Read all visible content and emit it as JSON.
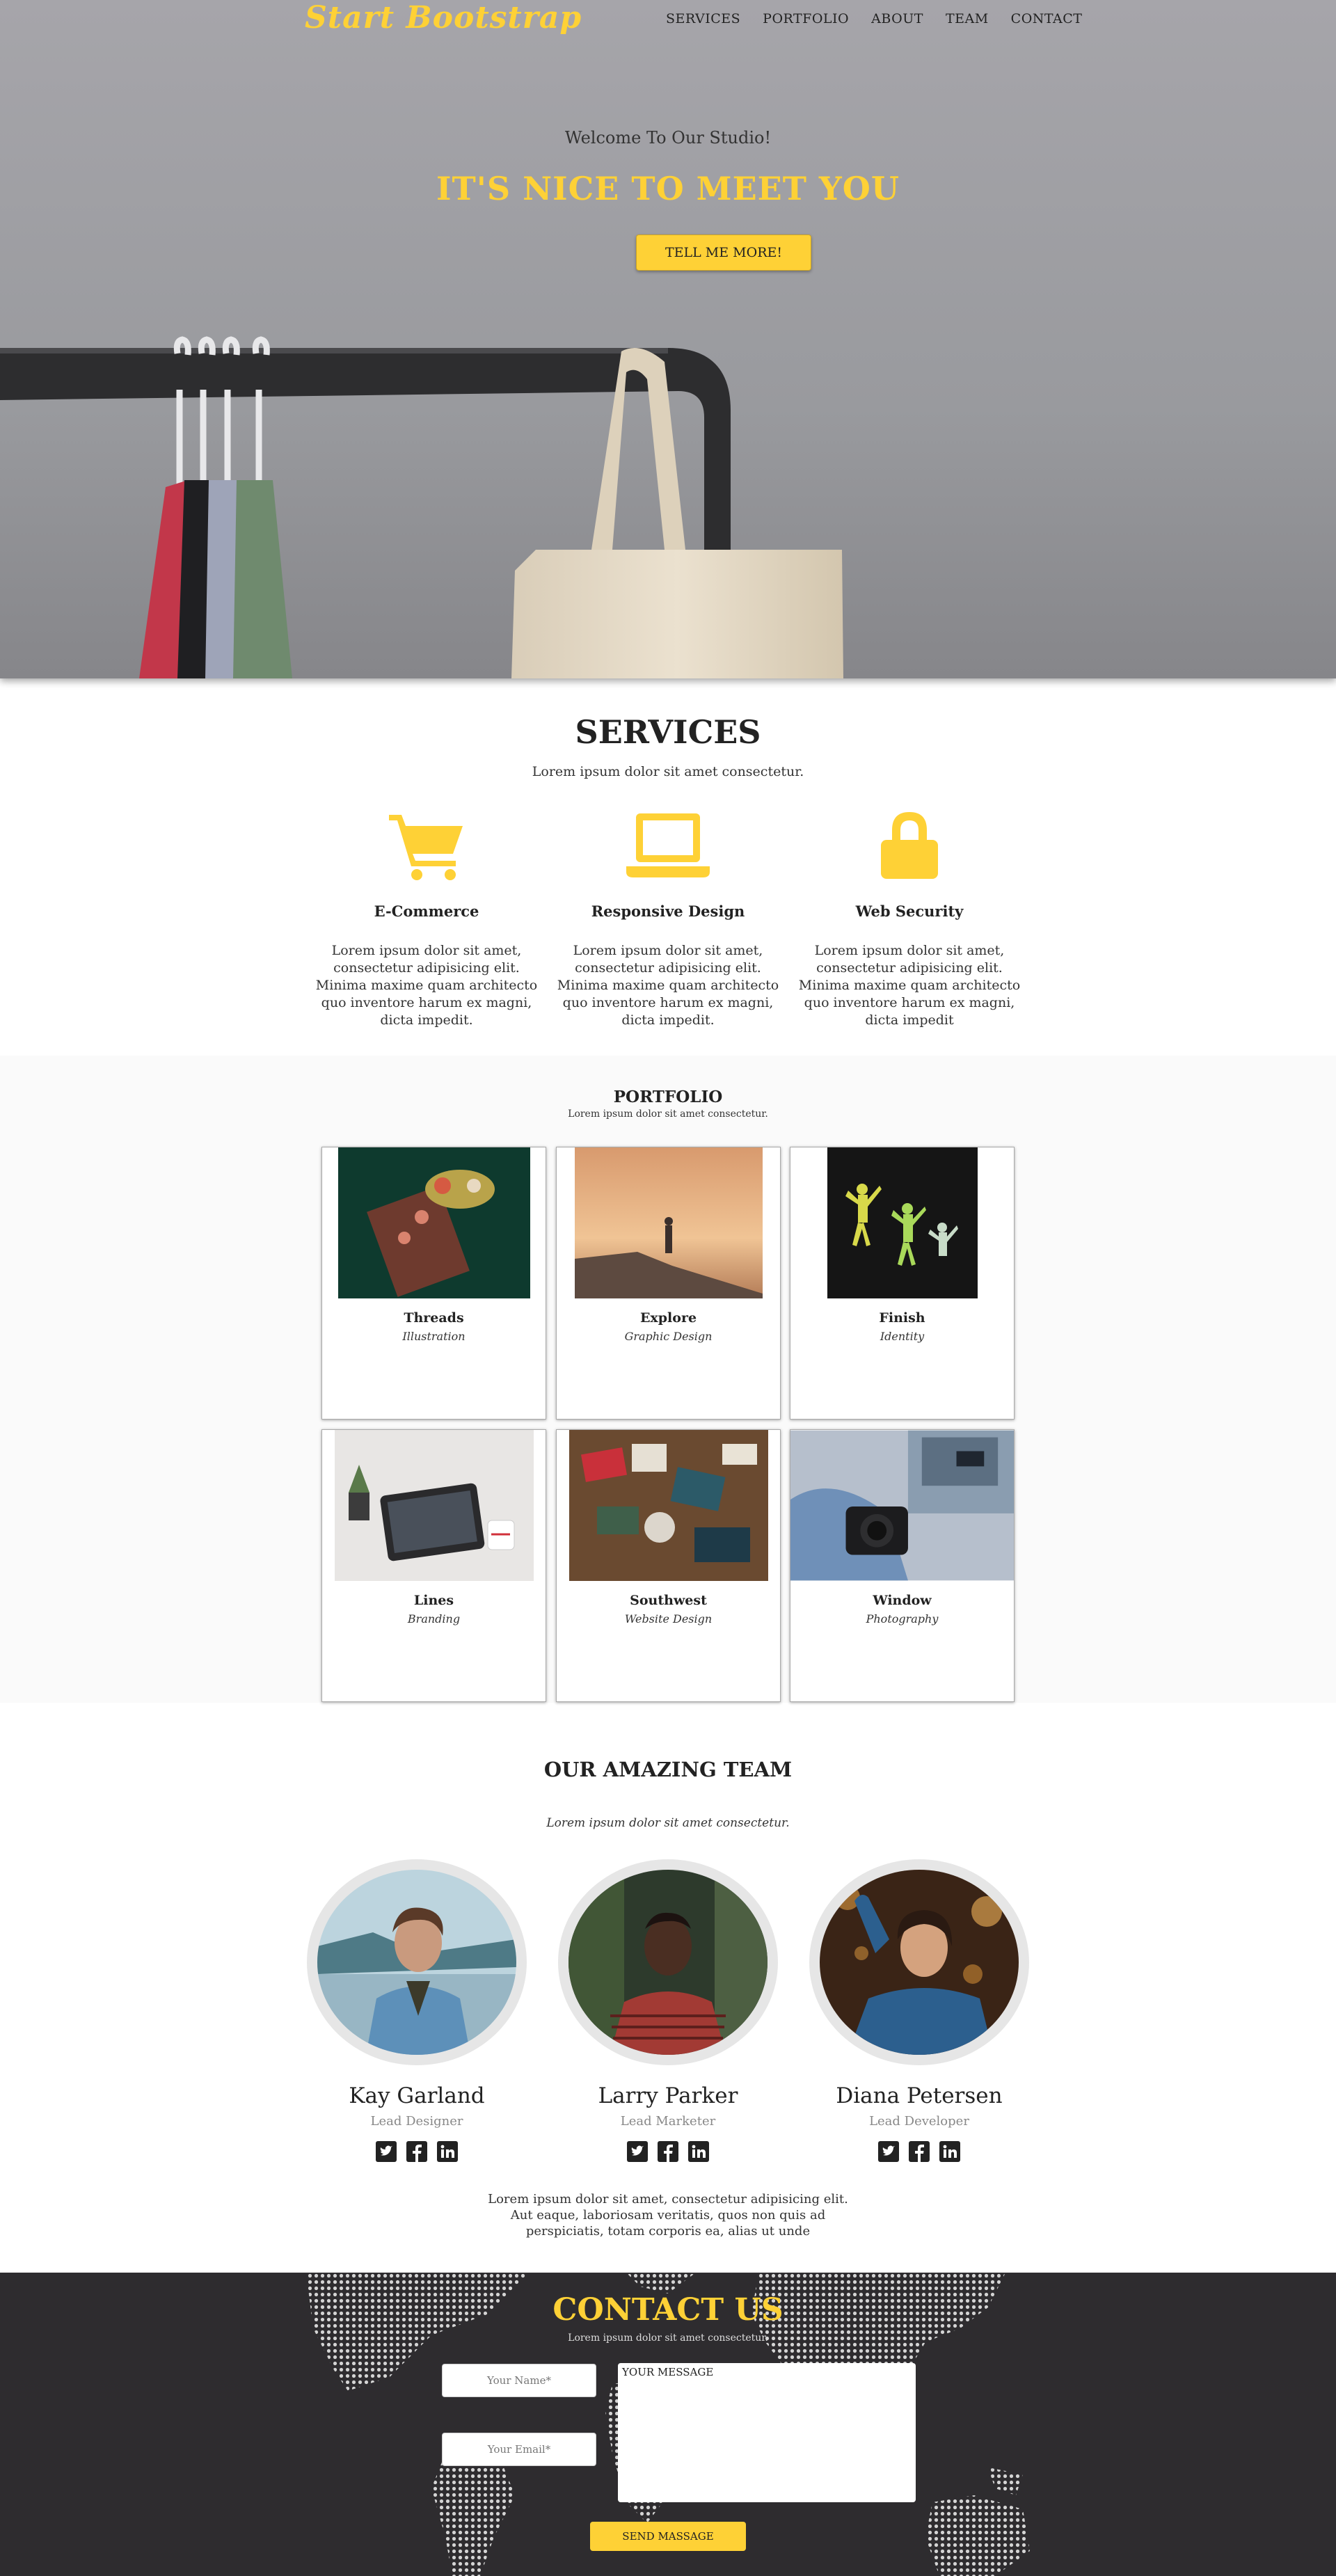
{
  "nav": {
    "brand": "Start Bootstrap",
    "items": [
      "SERVICES",
      "PORTFOLIO",
      "ABOUT",
      "TEAM",
      "CONTACT"
    ]
  },
  "hero": {
    "subtitle": "Welcome To Our Studio!",
    "title": "IT'S NICE TO MEET YOU",
    "button": "TELL ME MORE!"
  },
  "services": {
    "title": "SERVICES",
    "subtitle": "Lorem ipsum dolor sit amet consectetur.",
    "items": [
      {
        "icon": "shopping-cart-icon",
        "title": "E-Commerce",
        "text": "Lorem ipsum dolor sit amet, consectetur adipisicing elit. Minima maxime quam architecto quo inventore harum ex magni, dicta impedit."
      },
      {
        "icon": "laptop-icon",
        "title": "Responsive Design",
        "text": "Lorem ipsum dolor sit amet, consectetur adipisicing elit. Minima maxime quam architecto quo inventore harum ex magni, dicta impedit."
      },
      {
        "icon": "lock-icon",
        "title": "Web Security",
        "text": "Lorem ipsum dolor sit amet, consectetur adipisicing elit. Minima maxime quam architecto quo inventore harum ex magni, dicta impedit"
      }
    ]
  },
  "portfolio": {
    "title": "PORTFOLIO",
    "subtitle": "Lorem ipsum dolor sit amet consectetur.",
    "items": [
      {
        "title": "Threads",
        "category": "Illustration"
      },
      {
        "title": "Explore",
        "category": "Graphic Design"
      },
      {
        "title": "Finish",
        "category": "Identity"
      },
      {
        "title": "Lines",
        "category": "Branding"
      },
      {
        "title": "Southwest",
        "category": "Website Design"
      },
      {
        "title": "Window",
        "category": "Photography"
      }
    ]
  },
  "team": {
    "title": "OUR AMAZING TEAM",
    "subtitle": "Lorem ipsum dolor sit amet consectetur.",
    "members": [
      {
        "name": "Kay Garland",
        "role": "Lead Designer"
      },
      {
        "name": "Larry Parker",
        "role": "Lead Marketer"
      },
      {
        "name": "Diana Petersen",
        "role": "Lead Developer"
      }
    ],
    "footer_text": "Lorem ipsum dolor sit amet, consectetur adipisicing elit. Aut eaque, laboriosam veritatis, quos non quis ad perspiciatis, totam corporis ea, alias ut unde"
  },
  "contact": {
    "title": "CONTACT US",
    "subtitle": "Lorem ipsum dolor sit amet consectetur.",
    "name_placeholder": "Your Name*",
    "email_placeholder": "Your Email*",
    "message_label": "YOUR MESSAGE",
    "send_button": "SEND MASSAGE"
  },
  "colors": {
    "accent": "#fed136",
    "dark": "#2e2c2f"
  }
}
